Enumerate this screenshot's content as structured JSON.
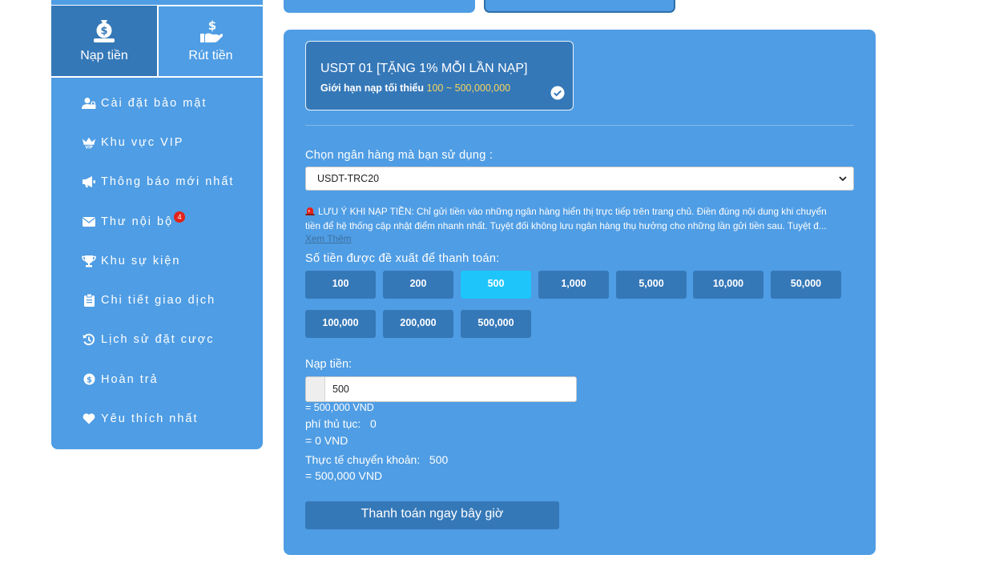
{
  "sidebar": {
    "tabs": [
      {
        "label": "Nạp tiền",
        "icon": "money-bag-icon",
        "active": true
      },
      {
        "label": "Rút tiền",
        "icon": "hand-dollar-icon",
        "active": false
      }
    ],
    "items": [
      {
        "label": "Cài đặt bảo mật",
        "icon": "user-lock-icon"
      },
      {
        "label": "Khu vực VIP",
        "icon": "vip-crown-icon"
      },
      {
        "label": "Thông báo mới nhất",
        "icon": "megaphone-icon"
      },
      {
        "label": "Thư nội bộ",
        "icon": "envelope-icon",
        "badge": "4"
      },
      {
        "label": "Khu sự kiện",
        "icon": "trophy-icon"
      },
      {
        "label": "Chi tiết giao dịch",
        "icon": "clipboard-icon"
      },
      {
        "label": "Lịch sử đặt cược",
        "icon": "history-icon"
      },
      {
        "label": "Hoàn trả",
        "icon": "dollar-coin-icon"
      },
      {
        "label": "Yêu thích nhất",
        "icon": "heart-icon"
      }
    ]
  },
  "deposit": {
    "method_card": {
      "title": "USDT 01 [TẶNG 1% MỖI LẦN NẠP]",
      "limit_prefix": "Giới hạn nạp tối thiểu",
      "limit_range": "100 ~ 500,000,000",
      "selected": true
    },
    "bank_label": "Chọn ngân hàng mà bạn sử dụng :",
    "bank_selected": "USDT-TRC20",
    "notice_line1": "LƯU Ý KHI NẠP TIỀN: Chỉ gửi tiền vào những ngân hàng hiển thị trực tiếp trên trang chủ. Điền đúng nội dung khi chuyển",
    "notice_line2": "tiền để hệ thống cập nhật điểm nhanh nhất. Tuyệt đối không lưu ngân hàng thụ hưởng cho những lần gửi tiền sau. Tuyệt đ...",
    "see_more": "Xem Thêm",
    "suggest_label": "Số tiền được đề xuất để thanh toán:",
    "amounts": [
      "100",
      "200",
      "500",
      "1,000",
      "5,000",
      "10,000",
      "50,000",
      "100,000",
      "200,000",
      "500,000"
    ],
    "selected_amount": "500",
    "amount_label": "Nạp tiền:",
    "amount_value": "500",
    "amount_vnd": "= 500,000 VND",
    "fee_text": "phí thủ tục:   0",
    "fee_vnd": "= 0 VND",
    "actual_text": "Thực tế chuyển khoản:   500",
    "actual_vnd": "= 500,000 VND",
    "pay_button": "Thanh toán ngay bây giờ"
  },
  "colors": {
    "panel": "#4f9de4",
    "active_dark": "#3578b8",
    "selected_amount": "#1ec5fb",
    "highlight": "#f6d55c",
    "badge": "#e2231a"
  }
}
